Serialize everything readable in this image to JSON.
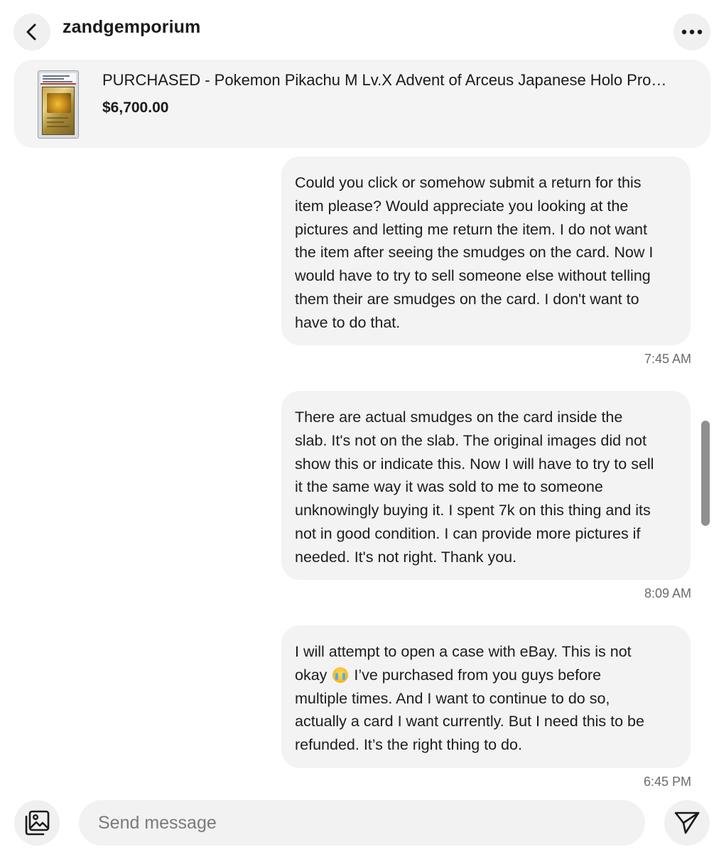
{
  "header": {
    "title": "zandgemporium",
    "back_icon": "chevron-left-icon",
    "more_icon": "ellipsis-icon"
  },
  "item": {
    "title": "PURCHASED - Pokemon Pikachu M Lv.X Advent of Arceus Japanese Holo Pro…",
    "price": "$6,700.00"
  },
  "messages": [
    {
      "text": "Could you click or somehow submit a return for this\nitem please? Would appreciate you looking at the\npictures and letting me return the item. I do not want\nthe item after seeing the smudges on the card. Now I\nwould have to try to sell someone else without telling\nthem their are smudges on the card. I don't want to\nhave to do that.",
      "time": "7:45 AM"
    },
    {
      "text": "There are actual smudges on the card inside the\nslab. It's not on the slab. The original images did not\nshow this or indicate this. Now I will have to try to sell\nit the same way it was sold to me to someone\nunknowingly buying it. I spent 7k on this thing and its\nnot in good condition. I can provide more pictures if\nneeded. It's not right. Thank you.",
      "time": "8:09 AM"
    },
    {
      "text_before_emoji": "I will attempt to open a case with eBay. This is not\nokay ",
      "text_after_emoji": " I’ve purchased from you guys before\nmultiple times. And I want to continue to do so,\nactually a card I want currently. But I need this to be\nrefunded. It’s the right thing to do.",
      "emoji": "loudly-crying-face",
      "time": "6:45 PM"
    }
  ],
  "composer": {
    "placeholder": "Send message",
    "gallery_icon": "image-gallery-icon",
    "send_icon": "send-icon"
  }
}
